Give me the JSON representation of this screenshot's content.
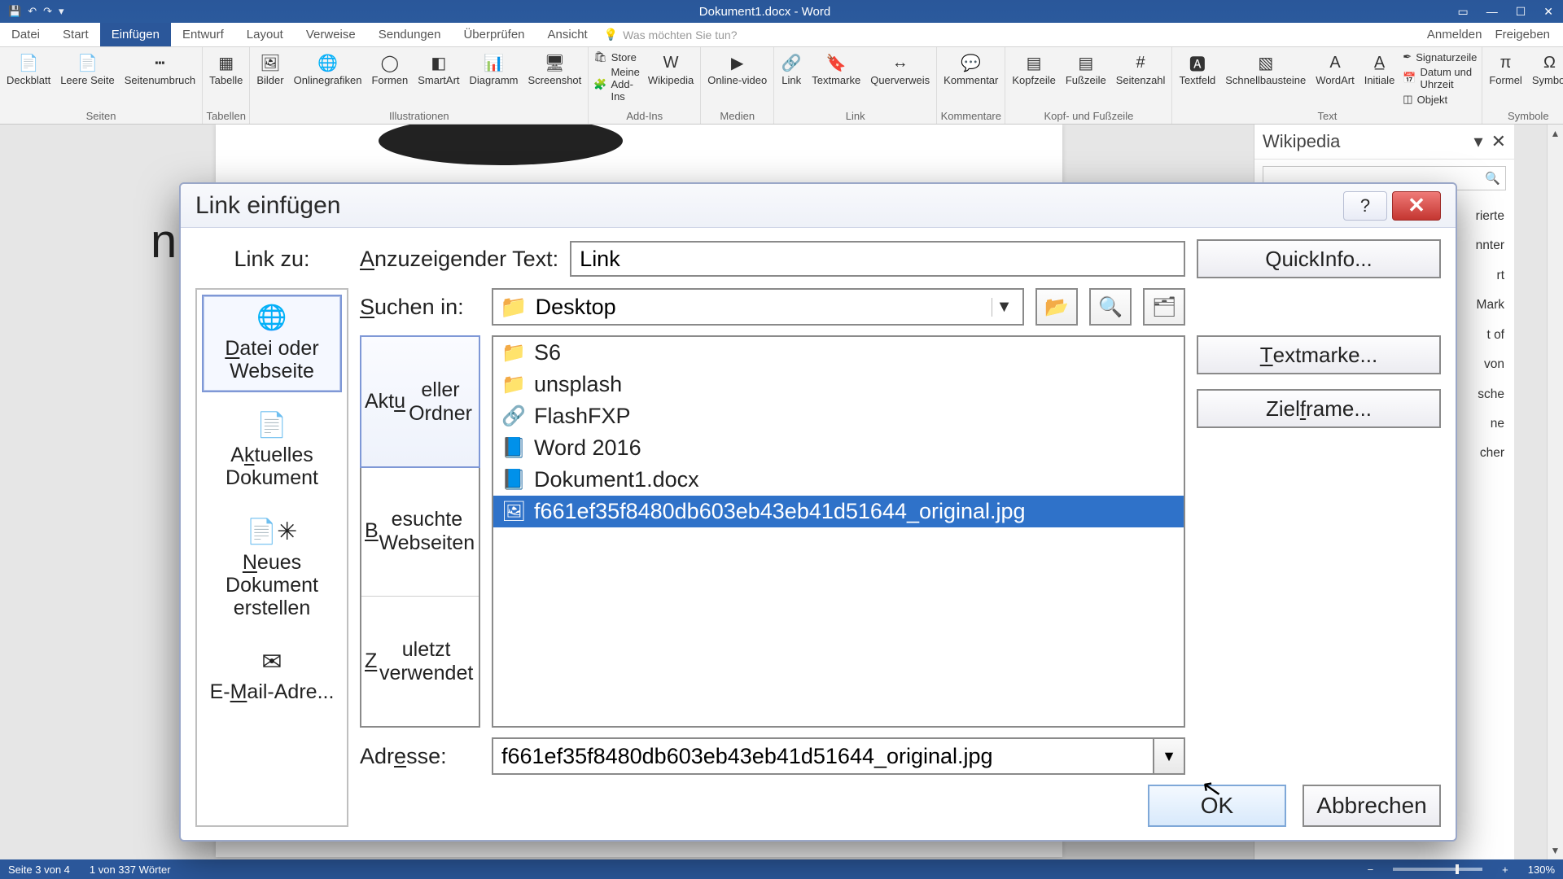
{
  "app": {
    "title": "Dokument1.docx - Word",
    "tabs": [
      "Datei",
      "Start",
      "Einfügen",
      "Entwurf",
      "Layout",
      "Verweise",
      "Sendungen",
      "Überprüfen",
      "Ansicht"
    ],
    "active_tab": 2,
    "tellme": "Was möchten Sie tun?",
    "signin": "Anmelden",
    "share": "Freigeben"
  },
  "ribbon": {
    "g_pages": {
      "caption": "Seiten",
      "items": [
        "Deckblatt",
        "Leere Seite",
        "Seitenumbruch"
      ]
    },
    "g_tables": {
      "caption": "Tabellen",
      "items": [
        "Tabelle"
      ]
    },
    "g_illus": {
      "caption": "Illustrationen",
      "items": [
        "Bilder",
        "Onlinegrafiken",
        "Formen",
        "SmartArt",
        "Diagramm",
        "Screenshot"
      ]
    },
    "g_addins": {
      "caption": "Add-Ins",
      "store": "Store",
      "mine": "Meine Add-Ins",
      "wiki": "Wikipedia"
    },
    "g_media": {
      "caption": "Medien",
      "items": [
        "Online-video"
      ]
    },
    "g_link": {
      "caption": "Link",
      "items": [
        "Link",
        "Textmarke",
        "Querverweis"
      ]
    },
    "g_comment": {
      "caption": "Kommentare",
      "items": [
        "Kommentar"
      ]
    },
    "g_hf": {
      "caption": "Kopf- und Fußzeile",
      "items": [
        "Kopfzeile",
        "Fußzeile",
        "Seitenzahl"
      ]
    },
    "g_text": {
      "caption": "Text",
      "items": [
        "Textfeld",
        "Schnellbausteine",
        "WordArt",
        "Initiale"
      ],
      "mini": [
        "Signaturzeile",
        "Datum und Uhrzeit",
        "Objekt"
      ]
    },
    "g_sym": {
      "caption": "Symbole",
      "items": [
        "Formel",
        "Symbol"
      ]
    }
  },
  "wiki": {
    "title": "Wikipedia",
    "lines": [
      "rierte",
      "nnter",
      "rt",
      "Mark",
      "t of",
      "von",
      "sche",
      "ne",
      "cher"
    ]
  },
  "status": {
    "page": "Seite 3 von 4",
    "words": "1 von 337 Wörter",
    "zoom": "130%"
  },
  "dialog": {
    "title": "Link einfügen",
    "linkzu": "Link zu:",
    "displaylabel": "Anzuzeigender Text:",
    "displayvalue": "Link",
    "quickinfo": "QuickInfo...",
    "suchenin": "Suchen in:",
    "suchenval": "Desktop",
    "textmarke": "Textmarke...",
    "zielframe": "Zielframe...",
    "linktypes": [
      {
        "label": "Datei oder Webseite",
        "icon": "🌐"
      },
      {
        "label": "Aktuelles Dokument",
        "icon": "📄"
      },
      {
        "label": "Neues Dokument erstellen",
        "icon": "📄"
      },
      {
        "label": "E-Mail-Adre...",
        "icon": "✉"
      }
    ],
    "browse_tabs": [
      "Aktueller Ordner",
      "Besuchte Webseiten",
      "Zuletzt verwendet"
    ],
    "files": [
      {
        "name": "S6",
        "icon": "📁"
      },
      {
        "name": "unsplash",
        "icon": "📁"
      },
      {
        "name": "FlashFXP",
        "icon": "🔗"
      },
      {
        "name": "Word 2016",
        "icon": "📘"
      },
      {
        "name": "Dokument1.docx",
        "icon": "📘"
      },
      {
        "name": "f661ef35f8480db603eb43eb41d51644_original.jpg",
        "icon": "🖼"
      }
    ],
    "selected_file_index": 5,
    "adresse_label": "Adresse:",
    "adresse_value": "f661ef35f8480db603eb43eb41d51644_original.jpg",
    "ok": "OK",
    "cancel": "Abbrechen"
  }
}
